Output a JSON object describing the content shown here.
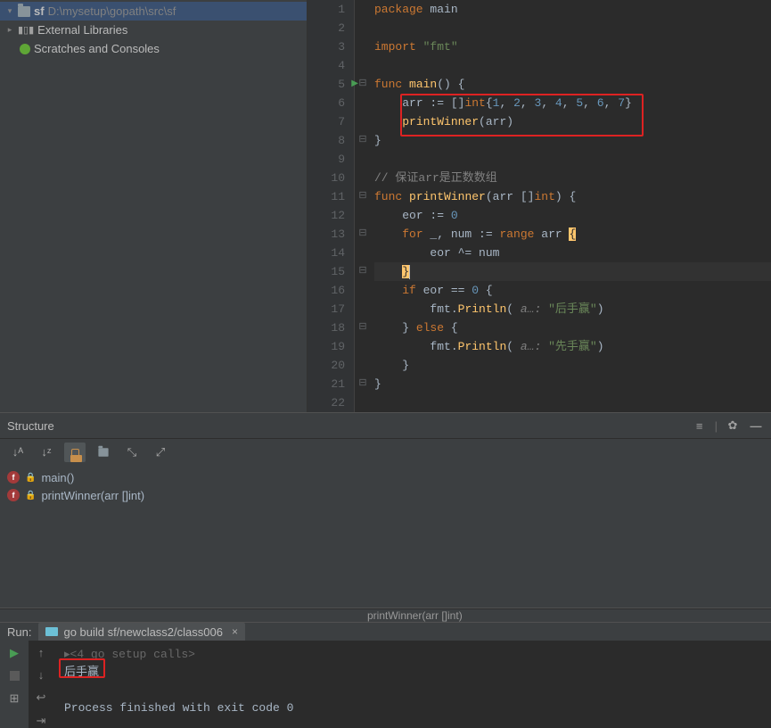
{
  "tree": {
    "root_name": "sf",
    "root_path": "D:\\mysetup\\gopath\\src\\sf",
    "external_libs": "External Libraries",
    "scratches": "Scratches and Consoles"
  },
  "editor": {
    "lines": [
      {
        "n": 1
      },
      {
        "n": 2
      },
      {
        "n": 3
      },
      {
        "n": 4
      },
      {
        "n": 5
      },
      {
        "n": 6
      },
      {
        "n": 7
      },
      {
        "n": 8
      },
      {
        "n": 9
      },
      {
        "n": 10
      },
      {
        "n": 11
      },
      {
        "n": 12
      },
      {
        "n": 13
      },
      {
        "n": 14
      },
      {
        "n": 15
      },
      {
        "n": 16
      },
      {
        "n": 17
      },
      {
        "n": 18
      },
      {
        "n": 19
      },
      {
        "n": 20
      },
      {
        "n": 21
      },
      {
        "n": 22
      }
    ],
    "code": {
      "pkg_kw": "package",
      "pkg": "main",
      "import_kw": "import",
      "import_val": "\"fmt\"",
      "func_kw": "func",
      "main_fn": "main",
      "arr_assign": "arr := []",
      "int_kw": "int",
      "arr_vals": [
        "1",
        "2",
        "3",
        "4",
        "5",
        "6",
        "7"
      ],
      "call_print": "printWinner",
      "arr_ref": "arr",
      "comment": "// 保证arr是正数数组",
      "pw_fn": "printWinner",
      "arr_param": "arr []",
      "int_kw2": "int",
      "eor_init": "eor := ",
      "zero": "0",
      "for_kw": "for",
      "range_kw": "range",
      "range_line": " _, num := ",
      "xor_line": "eor ^= num",
      "if_kw": "if",
      "eq": " eor == ",
      "zero2": "0",
      "println": "Println",
      "fmt_pkg": "fmt",
      "hint": "a…:",
      "msg1": "\"后手赢\"",
      "else_kw": "else",
      "msg2": "\"先手赢\""
    }
  },
  "structure": {
    "title": "Structure",
    "items": [
      {
        "name": "main()"
      },
      {
        "name": "printWinner(arr []int)"
      }
    ]
  },
  "breadcrumb": "printWinner(arr []int)",
  "run": {
    "title": "Run:",
    "tab_label": "go build sf/newclass2/class006",
    "setup_calls": "<4 go setup calls>",
    "output": "后手赢",
    "exit": "Process finished with exit code 0"
  }
}
